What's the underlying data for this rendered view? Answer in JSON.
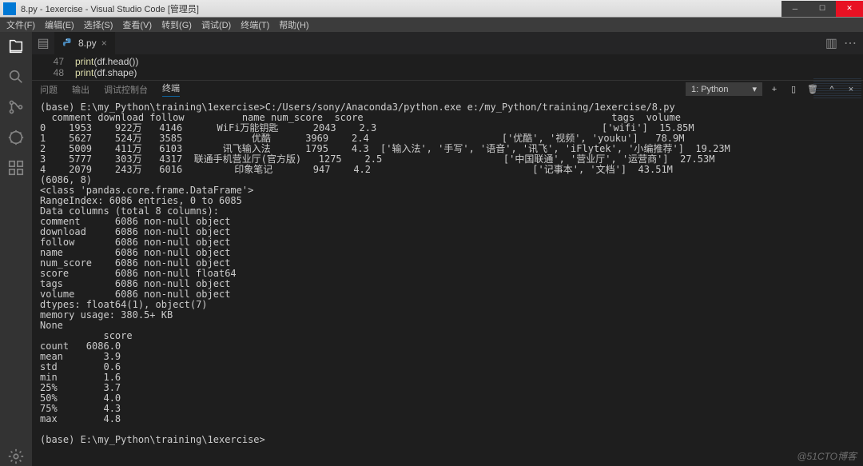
{
  "window": {
    "title": "8.py - 1exercise - Visual Studio Code [管理员]"
  },
  "menu": [
    "文件(F)",
    "编辑(E)",
    "选择(S)",
    "查看(V)",
    "转到(G)",
    "调试(D)",
    "终端(T)",
    "帮助(H)"
  ],
  "tab": {
    "filename": "8.py"
  },
  "editor": {
    "lines": [
      {
        "num": "47",
        "code_a": "print",
        "code_b": "(df.head())"
      },
      {
        "num": "48",
        "code_a": "print",
        "code_b": "(df.shape)"
      }
    ]
  },
  "panel_tabs": [
    "问题",
    "输出",
    "调试控制台",
    "终端"
  ],
  "panel_active": 3,
  "terminal_selector": "1: Python",
  "terminal_output": "(base) E:\\my_Python\\training\\1exercise>C:/Users/sony/Anaconda3/python.exe e:/my_Python/training/1exercise/8.py\n  comment download follow          name num_score  score                                           tags  volume\n0    1953    922万   4146      WiFi万能钥匙      2043    2.3                                       ['wifi']  15.85M\n1    5627    524万   3585            优酷      3969    2.4                       ['优酷', '视频', 'youku']   78.9M\n2    5009    411万   6103       讯飞输入法      1795    4.3  ['输入法', '手写', '语音', '讯飞', 'iFlytek', '小编推荐']  19.23M\n3    5777    303万   4317  联通手机营业厅(官方版)   1275    2.5                     ['中国联通', '营业厅', '运营商']  27.53M\n4    2079    243万   6016         印象笔记       947    4.2                            ['记事本', '文档']  43.51M\n(6086, 8)\n<class 'pandas.core.frame.DataFrame'>\nRangeIndex: 6086 entries, 0 to 6085\nData columns (total 8 columns):\ncomment      6086 non-null object\ndownload     6086 non-null object\nfollow       6086 non-null object\nname         6086 non-null object\nnum_score    6086 non-null object\nscore        6086 non-null float64\ntags         6086 non-null object\nvolume       6086 non-null object\ndtypes: float64(1), object(7)\nmemory usage: 380.5+ KB\nNone\n           score\ncount   6086.0\nmean       3.9\nstd        0.6\nmin        1.6\n25%        3.7\n50%        4.0\n75%        4.3\nmax        4.8\n\n(base) E:\\my_Python\\training\\1exercise>",
  "watermark": "@51CTO博客"
}
